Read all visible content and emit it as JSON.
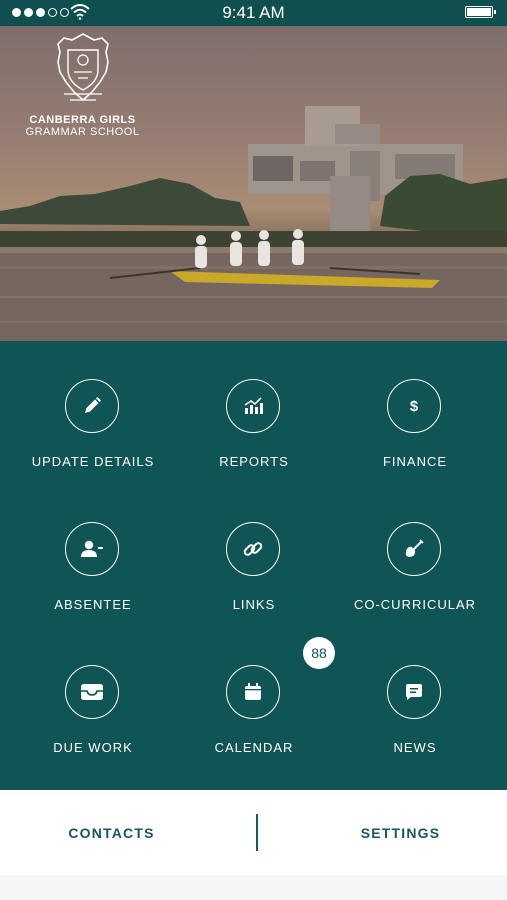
{
  "status_bar": {
    "time": "9:41 AM",
    "signal_icon": "signal-dots-icon",
    "wifi_icon": "wifi-icon",
    "battery_icon": "battery-icon"
  },
  "header": {
    "school_name_line1": "CANBERRA GIRLS",
    "school_name_line2": "GRAMMAR SCHOOL",
    "crest_icon": "school-crest-icon"
  },
  "menu": [
    {
      "label": "UPDATE DETAILS",
      "icon": "pencil-icon"
    },
    {
      "label": "REPORTS",
      "icon": "bar-chart-icon"
    },
    {
      "label": "FINANCE",
      "icon": "dollar-icon"
    },
    {
      "label": "ABSENTEE",
      "icon": "person-minus-icon"
    },
    {
      "label": "LINKS",
      "icon": "link-icon"
    },
    {
      "label": "CO-CURRICULAR",
      "icon": "guitar-icon"
    },
    {
      "label": "DUE WORK",
      "icon": "inbox-tray-icon"
    },
    {
      "label": "CALENDAR",
      "icon": "calendar-icon"
    },
    {
      "label": "NEWS",
      "icon": "chat-bubble-icon"
    }
  ],
  "calendar_badge": "88",
  "bottom_bar": {
    "contacts": "CONTACTS",
    "settings": "SETTINGS"
  },
  "colors": {
    "teal": "#0f5556",
    "teal_text": "#17585a",
    "white": "#ffffff"
  }
}
